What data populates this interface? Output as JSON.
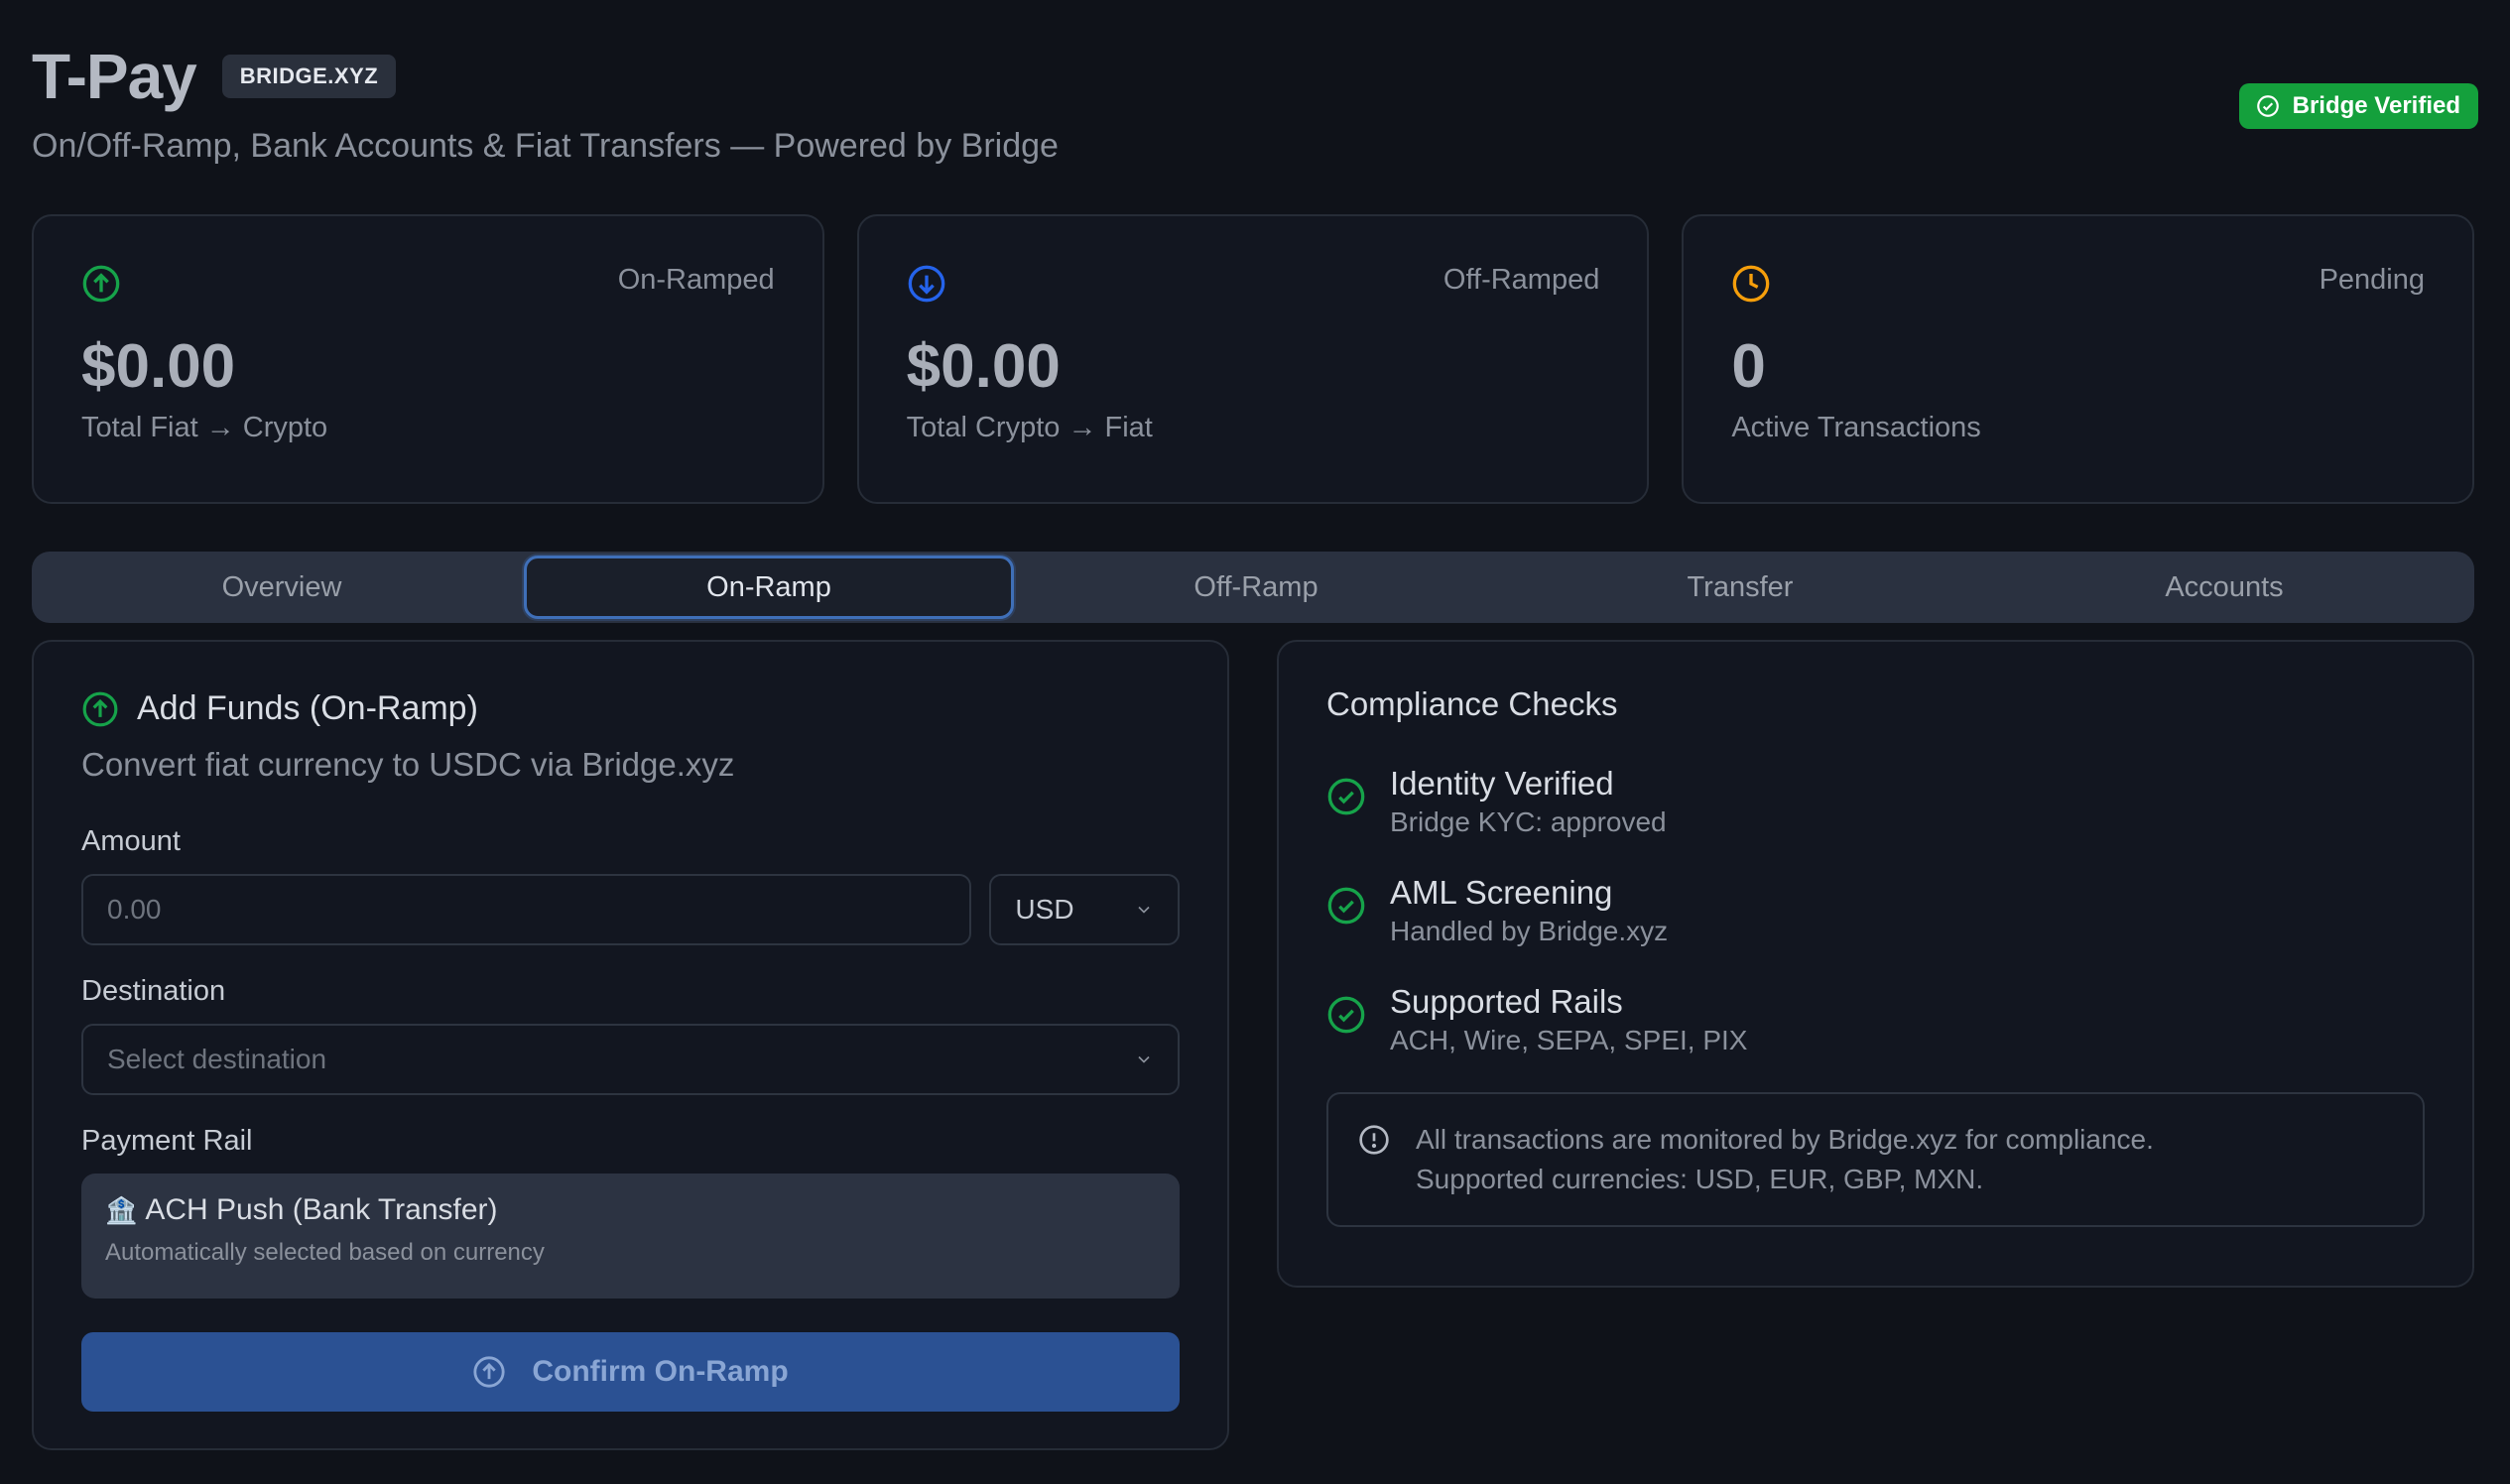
{
  "header": {
    "brand": "T-Pay",
    "brand_tag": "BRIDGE.XYZ",
    "subtitle": "On/Off-Ramp, Bank Accounts & Fiat Transfers — Powered by Bridge",
    "verified_badge": "Bridge Verified"
  },
  "stats": [
    {
      "label": "On-Ramped",
      "value": "$0.00",
      "sub": "Total Fiat → Crypto",
      "icon": "arrow-up-circle-icon",
      "color": "#16a34a"
    },
    {
      "label": "Off-Ramped",
      "value": "$0.00",
      "sub": "Total Crypto → Fiat",
      "icon": "arrow-down-circle-icon",
      "color": "#2563eb"
    },
    {
      "label": "Pending",
      "value": "0",
      "sub": "Active Transactions",
      "icon": "clock-icon",
      "color": "#f59e0b"
    }
  ],
  "tabs": [
    {
      "label": "Overview"
    },
    {
      "label": "On-Ramp"
    },
    {
      "label": "Off-Ramp"
    },
    {
      "label": "Transfer"
    },
    {
      "label": "Accounts"
    }
  ],
  "active_tab": "On-Ramp",
  "onramp": {
    "title": "Add Funds (On-Ramp)",
    "description": "Convert fiat currency to USDC via Bridge.xyz",
    "amount_label": "Amount",
    "amount_placeholder": "0.00",
    "currency": "USD",
    "destination_label": "Destination",
    "destination_placeholder": "Select destination",
    "rail_label": "Payment Rail",
    "rail_emoji": "🏦",
    "rail_title": "ACH Push (Bank Transfer)",
    "rail_sub": "Automatically selected based on currency",
    "confirm_label": "Confirm On-Ramp"
  },
  "compliance": {
    "title": "Compliance Checks",
    "items": [
      {
        "name": "Identity Verified",
        "desc": "Bridge KYC: approved"
      },
      {
        "name": "AML Screening",
        "desc": "Handled by Bridge.xyz"
      },
      {
        "name": "Supported Rails",
        "desc": "ACH, Wire, SEPA, SPEI, PIX"
      }
    ],
    "notice_line1": "All transactions are monitored by Bridge.xyz for compliance.",
    "notice_line2": "Supported currencies: USD, EUR, GBP, MXN."
  },
  "colors": {
    "success": "#16a34a",
    "accent_blue": "#2b5193",
    "warning": "#f59e0b"
  }
}
